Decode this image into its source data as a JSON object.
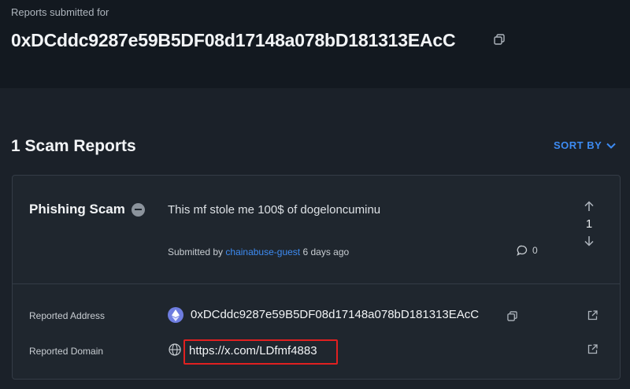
{
  "header": {
    "label": "Reports submitted for",
    "address": "0xDCddc9287e59B5DF08d17148a078bD181313EAcC"
  },
  "reports_section": {
    "title": "1 Scam Reports",
    "sort_label": "SORT BY"
  },
  "report": {
    "category": "Phishing Scam",
    "description": "This mf stole me 100$ of dogeloncuminu",
    "submitted_prefix": "Submitted by",
    "submitted_by": "chainabuse-guest",
    "submitted_time": "6 days ago",
    "comment_count": "0",
    "vote_count": "1",
    "reported_address_label": "Reported Address",
    "reported_address": "0xDCddc9287e59B5DF08d17148a078bD181313EAcC",
    "reported_domain_label": "Reported Domain",
    "reported_domain": "https://x.com/LDfmf4883"
  },
  "colors": {
    "accent": "#3d8bf2",
    "highlight_box": "#e02020",
    "eth_icon": "#6e7de0"
  },
  "icons": [
    "copy-icon",
    "chevron-down-icon",
    "minus-circle-icon",
    "upvote-arrow-icon",
    "downvote-arrow-icon",
    "comment-icon",
    "ethereum-icon",
    "globe-icon",
    "external-link-icon"
  ]
}
